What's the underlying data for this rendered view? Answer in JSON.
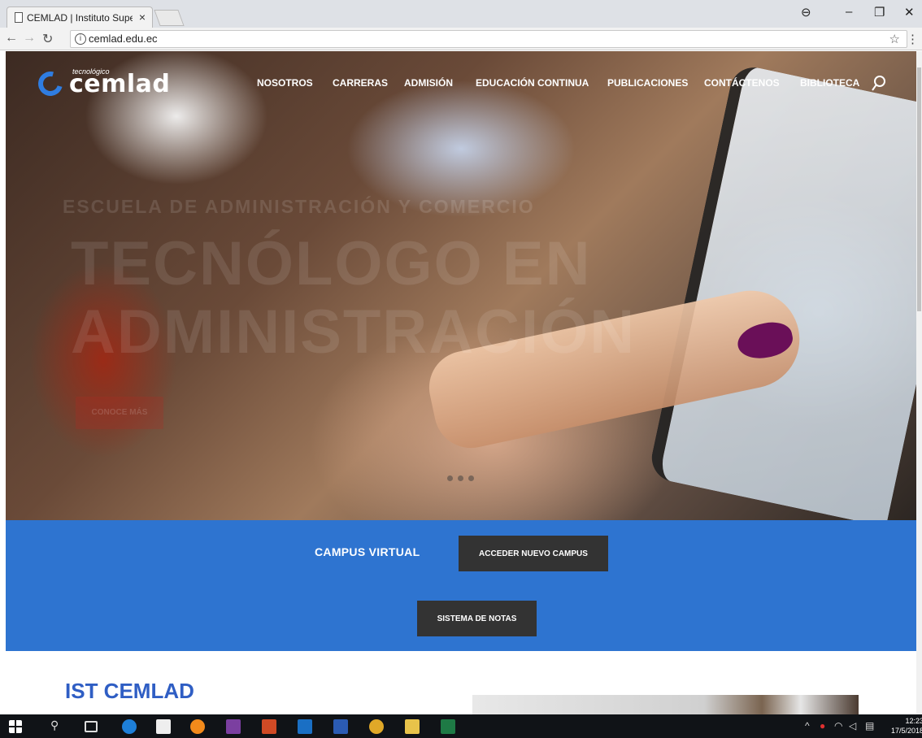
{
  "browser": {
    "tab_title": "CEMLAD | Instituto Supe",
    "url": "cemlad.edu.ec"
  },
  "site": {
    "logo_small": "tecnológico",
    "logo_text": "cemlad",
    "nav": [
      "NOSOTROS",
      "CARRERAS",
      "ADMISIÓN",
      "EDUCACIÓN CONTINUA",
      "PUBLICACIONES",
      "CONTÁCTENOS",
      "BIBLIOTECA"
    ]
  },
  "hero": {
    "subtitle": "ESCUELA DE ADMINISTRACIÓN Y COMERCIO",
    "title_line1": "TECNÓLOGO EN",
    "title_line2": "ADMINISTRACIÓN",
    "button": "CONOCE MÁS"
  },
  "campus": {
    "label": "CAMPUS VIRTUAL",
    "access_button": "ACCEDER NUEVO CAMPUS",
    "grades_button": "SISTEMA DE NOTAS"
  },
  "section": {
    "title": "IST CEMLAD"
  },
  "taskbar": {
    "time": "12:23",
    "date": "17/5/2018"
  },
  "colors": {
    "campus_bg": "#2e74d0",
    "dark_button": "#333333",
    "section_title": "#2f5ec4",
    "logo_accent": "#2f7de1"
  }
}
